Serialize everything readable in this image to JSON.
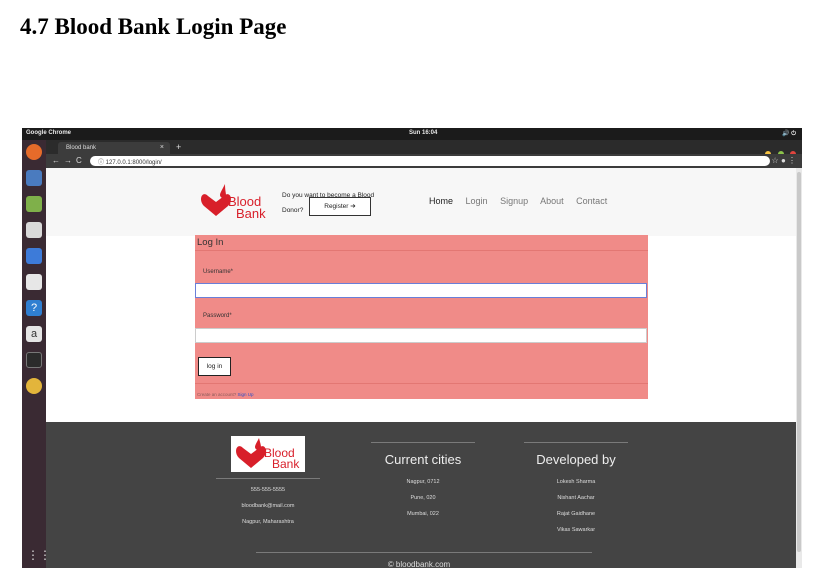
{
  "document": {
    "heading": "4.7 Blood Bank Login Page"
  },
  "system_bar": {
    "app_name": "Google Chrome",
    "time": "Sun 16:04"
  },
  "browser": {
    "tab_title": "Blood bank",
    "url": "127.0.0.1:8000/login/"
  },
  "header": {
    "logo_text_line1": "Blood",
    "logo_text_line2": "Bank",
    "donor_prompt_line1": "Do you want to become a Blood",
    "donor_prompt_line2": "Donor?",
    "register_label": "Register",
    "nav": [
      "Home",
      "Login",
      "Signup",
      "About",
      "Contact"
    ]
  },
  "login": {
    "title": "Log In",
    "username_label": "Username*",
    "password_label": "Password*",
    "button_label": "log in",
    "create_prompt": "Create an account?",
    "signup_link": "Sign Up"
  },
  "footer": {
    "contact": [
      "555-555-5555",
      "bloodbank@mail.com",
      "Nagpur, Maharashtra"
    ],
    "cities_title": "Current cities",
    "cities": [
      "Nagpur, 0712",
      "Pune, 020",
      "Mumbai, 022"
    ],
    "developed_title": "Developed by",
    "developers": [
      "Lokesh Sharma",
      "Nishant Aachar",
      "Rajat Gaidhane",
      "Vikas Sawarkar"
    ],
    "copyright": "© bloodbank.com"
  },
  "colors": {
    "accent_red": "#d81f2a",
    "login_panel": "#f08b88",
    "footer_bg": "#444444"
  }
}
